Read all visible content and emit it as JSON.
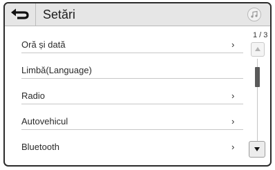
{
  "header": {
    "title": "Setări",
    "back_icon": "back-arrow-icon",
    "media_icon": "music-note-icon"
  },
  "menu": {
    "items": [
      {
        "label": "Oră și dată",
        "has_chevron": true,
        "chevron": "›"
      },
      {
        "label": "Limbă(Language)",
        "has_chevron": false,
        "chevron": ""
      },
      {
        "label": "Radio",
        "has_chevron": true,
        "chevron": "›"
      },
      {
        "label": "Autovehicul",
        "has_chevron": true,
        "chevron": "›"
      },
      {
        "label": "Bluetooth",
        "has_chevron": true,
        "chevron": "›"
      }
    ]
  },
  "pager": {
    "text": "1 / 3",
    "current_page": 1,
    "total_pages": 3,
    "up_icon": "scroll-up-arrow-icon",
    "down_icon": "scroll-down-arrow-icon"
  },
  "colors": {
    "header_bg": "#e6e6e6",
    "frame": "#2a2a2a",
    "text": "#222222",
    "thumb": "#5a5a5a"
  }
}
